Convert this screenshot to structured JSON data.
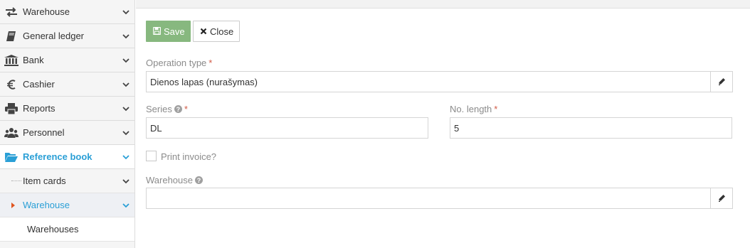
{
  "sidebar": {
    "items": [
      {
        "label": "Warehouse",
        "icon": "exchange-icon"
      },
      {
        "label": "General ledger",
        "icon": "book-icon"
      },
      {
        "label": "Bank",
        "icon": "bank-icon"
      },
      {
        "label": "Cashier",
        "icon": "euro-icon"
      },
      {
        "label": "Reports",
        "icon": "print-icon"
      },
      {
        "label": "Personnel",
        "icon": "users-icon"
      },
      {
        "label": "Reference book",
        "icon": "folder-open-icon",
        "active": true
      }
    ],
    "sub_items": [
      {
        "label": "Item cards"
      },
      {
        "label": "Warehouse",
        "active": true
      }
    ],
    "subsub_items": [
      {
        "label": "Warehouses"
      }
    ]
  },
  "toolbar": {
    "save_label": "Save",
    "close_label": "Close"
  },
  "form": {
    "operation_type": {
      "label": "Operation type",
      "required_mark": "*",
      "value": "Dienos lapas (nurašymas)"
    },
    "series": {
      "label": "Series",
      "required_mark": "*",
      "value": "DL"
    },
    "no_length": {
      "label": "No. length",
      "required_mark": "*",
      "value": "5"
    },
    "print_invoice": {
      "label": "Print invoice?",
      "checked": false
    },
    "warehouse": {
      "label": "Warehouse",
      "value": ""
    }
  },
  "colors": {
    "accent": "#2a9fd6",
    "save_button": "#87b87f",
    "required": "#d15b47",
    "caret": "#e0551f"
  }
}
